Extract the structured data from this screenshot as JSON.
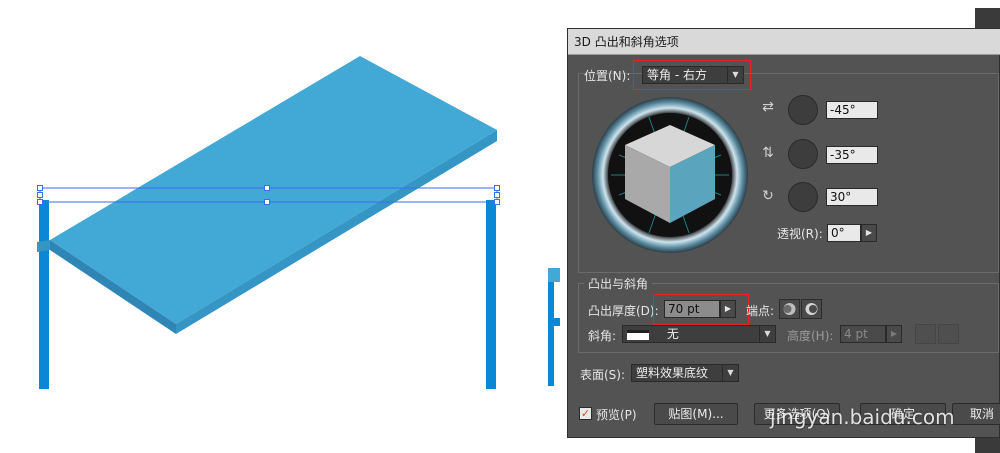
{
  "dialog": {
    "title": "3D 凸出和斜角选项",
    "position": {
      "label": "位置(N):",
      "value": "等角 - 右方",
      "x_rotation": "-45°",
      "y_rotation": "-35°",
      "z_rotation": "30°",
      "perspective_label": "透视(R):",
      "perspective_value": "0°"
    },
    "extrude": {
      "group_label": "凸出与斜角",
      "depth_label": "凸出厚度(D):",
      "depth_value": "70 pt",
      "cap_label": "端点:",
      "bevel_label": "斜角:",
      "bevel_value": "无",
      "height_label": "高度(H):",
      "height_value": "4 pt"
    },
    "surface": {
      "label": "表面(S):",
      "value": "塑料效果底纹"
    },
    "footer": {
      "preview_label": "预览(P)",
      "preview_checked": true,
      "map_button": "贴图(M)...",
      "more_options_button": "更多选项(O)",
      "ok_button": "确定",
      "cancel_button": "取消"
    }
  },
  "watermark": "jingyan.baidu.com",
  "colors": {
    "table_top": "#42a8d6",
    "table_edge": "#2f86b5",
    "legs": "#0a88d6",
    "dialog_bg": "#535353",
    "highlight_box": "#e0262b",
    "cube_right_face": "#5aa4bd"
  }
}
